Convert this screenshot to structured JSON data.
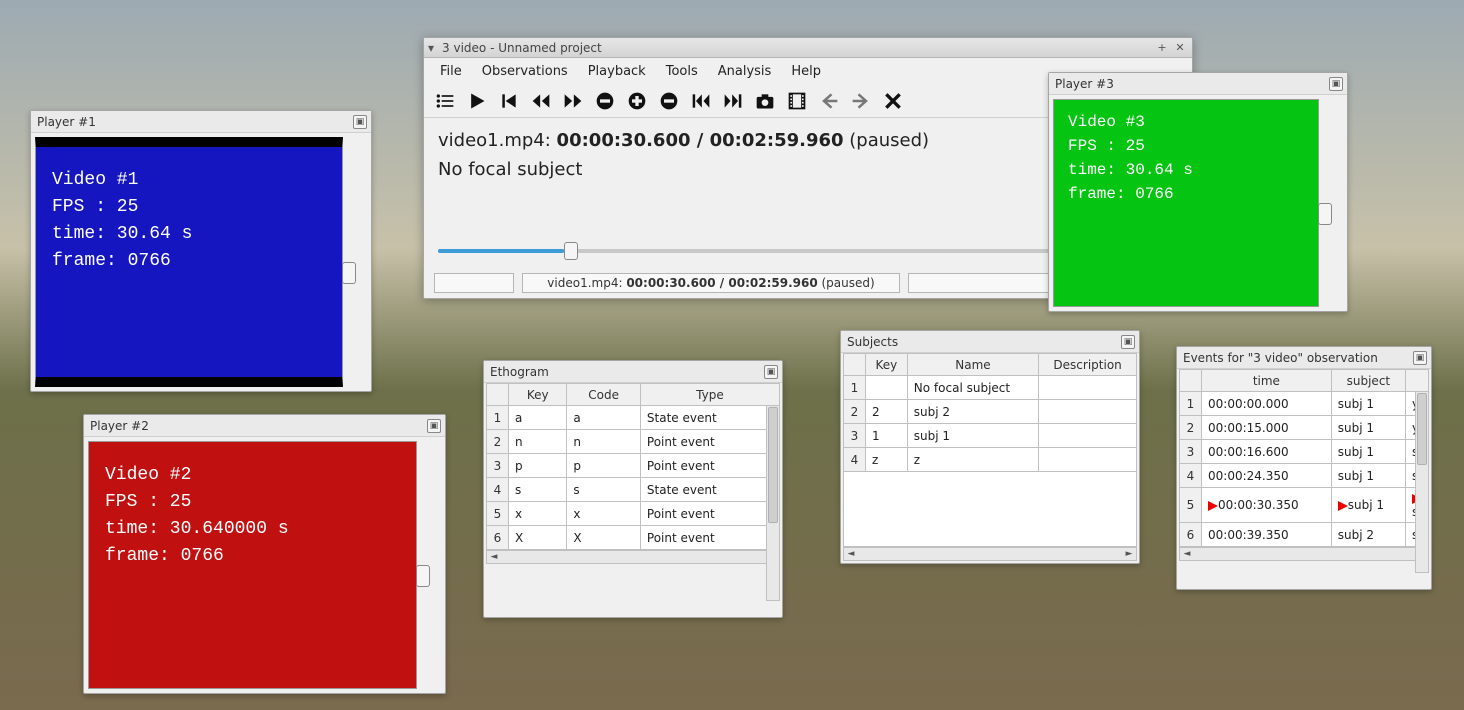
{
  "mainwin": {
    "title": "3 video - Unnamed project",
    "menu": [
      "File",
      "Observations",
      "Playback",
      "Tools",
      "Analysis",
      "Help"
    ],
    "video_label": "video1.mp4: ",
    "timecode": "00:00:30.600 / 00:02:59.960",
    "state": " (paused)",
    "subject_line": "No focal subject",
    "status1_pre": "video1.mp4: ",
    "status1_bold": "00:00:30.600 / 00:02:59.960",
    "status1_post": " (paused)"
  },
  "players": {
    "p1": {
      "title": "Player #1",
      "l1": "Video #1",
      "l2": "FPS : 25",
      "l3": "time: 30.64 s",
      "l4": "frame: 0766",
      "bg": "#1616c0"
    },
    "p2": {
      "title": "Player #2",
      "l1": "Video #2",
      "l2": "FPS : 25",
      "l3": "time: 30.640000 s",
      "l4": "frame: 0766",
      "bg": "#c01010"
    },
    "p3": {
      "title": "Player #3",
      "l1": "Video #3",
      "l2": "FPS : 25",
      "l3": "time: 30.64 s",
      "l4": "frame: 0766",
      "bg": "#06c412"
    }
  },
  "ethogram": {
    "title": "Ethogram",
    "cols": [
      "Key",
      "Code",
      "Type"
    ],
    "rows": [
      {
        "n": "1",
        "key": "a",
        "code": "a",
        "type": "State event"
      },
      {
        "n": "2",
        "key": "n",
        "code": "n",
        "type": "Point event"
      },
      {
        "n": "3",
        "key": "p",
        "code": "p",
        "type": "Point event"
      },
      {
        "n": "4",
        "key": "s",
        "code": "s",
        "type": "State event"
      },
      {
        "n": "5",
        "key": "x",
        "code": "x",
        "type": "Point event"
      },
      {
        "n": "6",
        "key": "X",
        "code": "X",
        "type": "Point event"
      }
    ]
  },
  "subjects": {
    "title": "Subjects",
    "cols": [
      "Key",
      "Name",
      "Description"
    ],
    "rows": [
      {
        "n": "1",
        "key": "",
        "name": "No focal subject",
        "desc": ""
      },
      {
        "n": "2",
        "key": "2",
        "name": "subj 2",
        "desc": ""
      },
      {
        "n": "3",
        "key": "1",
        "name": "subj 1",
        "desc": ""
      },
      {
        "n": "4",
        "key": "z",
        "name": "z",
        "desc": ""
      }
    ]
  },
  "events": {
    "title": "Events for \"3 video\" observation",
    "cols": [
      "time",
      "subject"
    ],
    "rows": [
      {
        "n": "1",
        "t": "00:00:00.000",
        "s": "subj 1",
        "b": "y"
      },
      {
        "n": "2",
        "t": "00:00:15.000",
        "s": "subj 1",
        "b": "y"
      },
      {
        "n": "3",
        "t": "00:00:16.600",
        "s": "subj 1",
        "b": "s"
      },
      {
        "n": "4",
        "t": "00:00:24.350",
        "s": "subj 1",
        "b": "s"
      },
      {
        "n": "5",
        "t": "00:00:30.350",
        "s": "subj 1",
        "b": "s"
      },
      {
        "n": "6",
        "t": "00:00:39.350",
        "s": "subj 2",
        "b": "s"
      }
    ]
  }
}
